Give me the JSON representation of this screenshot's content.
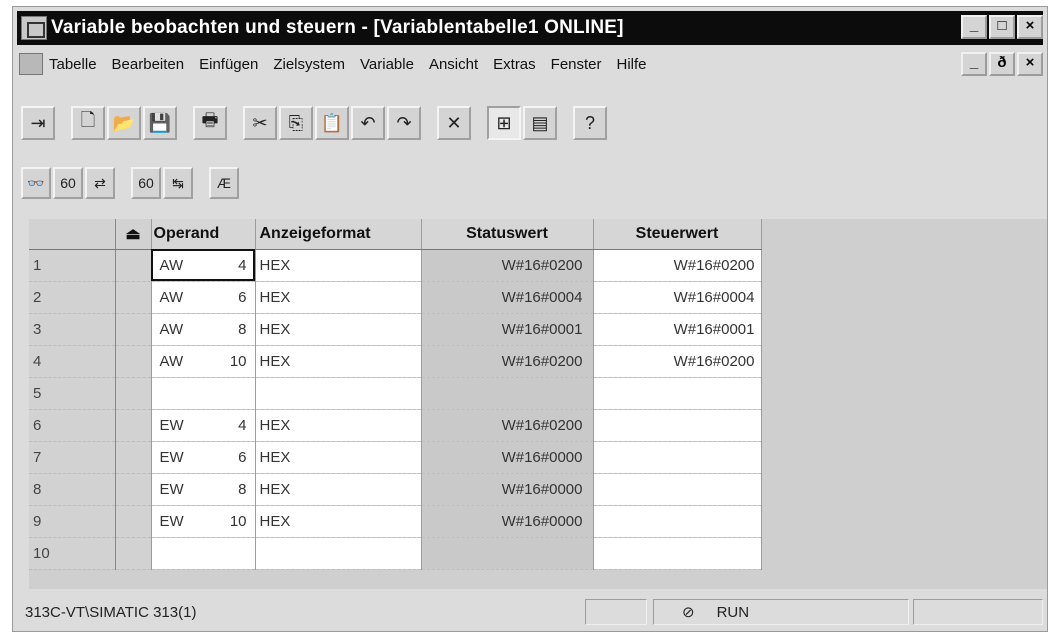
{
  "window": {
    "title": "Variable beobachten und steuern - [Variablentabelle1  ONLINE]",
    "buttons": [
      "_",
      "□",
      "×"
    ]
  },
  "menu": {
    "items": [
      "Tabelle",
      "Bearbeiten",
      "Einfügen",
      "Zielsystem",
      "Variable",
      "Ansicht",
      "Extras",
      "Fenster",
      "Hilfe"
    ],
    "child_buttons": [
      "_",
      "ð",
      "×"
    ]
  },
  "toolbar1": {
    "icons": [
      "pin-icon",
      "new-icon",
      "open-icon",
      "save-icon",
      "print-icon",
      "cut-icon",
      "copy-icon",
      "paste-icon",
      "undo-icon",
      "redo-icon",
      "delete-icon",
      "online-icon",
      "monitor-icon",
      "help-icon"
    ]
  },
  "toolbar2": {
    "icons": [
      "observe-icon",
      "control-icon",
      "activate-icon",
      "trigger-icon",
      "force-icon",
      "status-icon"
    ]
  },
  "table": {
    "headers": [
      "Operand",
      "Anzeigeformat",
      "Statuswert",
      "Steuerwert"
    ],
    "rows": [
      {
        "num": "1",
        "op": "AW",
        "addr": "4",
        "fmt": "HEX",
        "status": "W#16#0200",
        "control": "W#16#0200"
      },
      {
        "num": "2",
        "op": "AW",
        "addr": "6",
        "fmt": "HEX",
        "status": "W#16#0004",
        "control": "W#16#0004"
      },
      {
        "num": "3",
        "op": "AW",
        "addr": "8",
        "fmt": "HEX",
        "status": "W#16#0001",
        "control": "W#16#0001"
      },
      {
        "num": "4",
        "op": "AW",
        "addr": "10",
        "fmt": "HEX",
        "status": "W#16#0200",
        "control": "W#16#0200"
      },
      {
        "num": "5",
        "op": "",
        "addr": "",
        "fmt": "",
        "status": "",
        "control": ""
      },
      {
        "num": "6",
        "op": "EW",
        "addr": "4",
        "fmt": "HEX",
        "status": "W#16#0200",
        "control": ""
      },
      {
        "num": "7",
        "op": "EW",
        "addr": "6",
        "fmt": "HEX",
        "status": "W#16#0000",
        "control": ""
      },
      {
        "num": "8",
        "op": "EW",
        "addr": "8",
        "fmt": "HEX",
        "status": "W#16#0000",
        "control": ""
      },
      {
        "num": "9",
        "op": "EW",
        "addr": "10",
        "fmt": "HEX",
        "status": "W#16#0000",
        "control": ""
      },
      {
        "num": "10",
        "op": "",
        "addr": "",
        "fmt": "",
        "status": "",
        "control": ""
      }
    ]
  },
  "statusbar": {
    "path": "313C-VT\\SIMATIC 313(1)",
    "mode": "RUN"
  }
}
